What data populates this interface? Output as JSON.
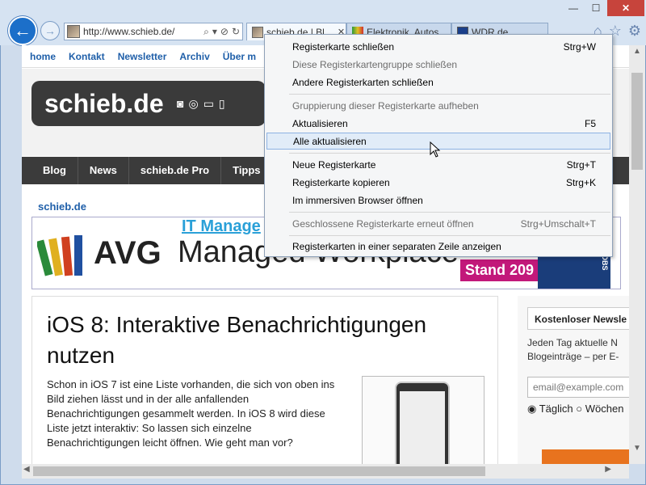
{
  "browser": {
    "address": "http://www.schieb.de/",
    "tabs": [
      {
        "label": "schieb.de | Bl...",
        "active": true
      },
      {
        "label": "Elektronik, Autos ...",
        "active": false
      },
      {
        "label": "WDR.de",
        "active": false
      }
    ],
    "window_controls": {
      "minimize": "—",
      "maximize": "☐",
      "close": "✕"
    },
    "icons": [
      "home-icon",
      "favorites-star-icon",
      "settings-gear-icon"
    ]
  },
  "page": {
    "topnav": [
      "home",
      "Kontakt",
      "Newsletter",
      "Archiv",
      "Über m"
    ],
    "logo": "schieb.de",
    "mainnav": [
      "Blog",
      "News",
      "schieb.de Pro",
      "Tipps"
    ],
    "site_label": "schieb.de",
    "banner": {
      "it_manage": "IT Manage",
      "brand": "AVG",
      "headline": "Managed Workplace",
      "stand": "Stand 209",
      "side_text": "JAKOBS"
    },
    "article": {
      "title": "iOS 8: Interaktive Benachrichtigungen nutzen",
      "body": "Schon in iOS 7 ist eine Liste vorhanden, die sich von oben ins Bild ziehen lässt und in der alle anfallenden Benachrichtigungen gesammelt werden. In iOS 8 wird diese Liste jetzt interaktiv: So lassen sich einzelne Benachrichtigungen leicht öffnen. Wie geht man vor?"
    },
    "sidebar": {
      "heading": "Kostenloser Newsle",
      "text_line1": "Jeden Tag aktuelle N",
      "text_line2": "Blogeinträge – per E-",
      "email_placeholder": "email@example.com",
      "radio_daily": "Täglich",
      "radio_weekly": "Wöchen"
    }
  },
  "context_menu": {
    "items": [
      {
        "label": "Registerkarte schließen",
        "shortcut": "Strg+W",
        "disabled": false
      },
      {
        "label": "Diese Registerkartengruppe schließen",
        "shortcut": "",
        "disabled": true
      },
      {
        "label": "Andere Registerkarten schließen",
        "shortcut": "",
        "disabled": false
      },
      {
        "label": "Gruppierung dieser Registerkarte aufheben",
        "shortcut": "",
        "disabled": true
      },
      {
        "label": "Aktualisieren",
        "shortcut": "F5",
        "disabled": false
      },
      {
        "label": "Alle aktualisieren",
        "shortcut": "",
        "disabled": false,
        "hover": true
      },
      {
        "label": "Neue Registerkarte",
        "shortcut": "Strg+T",
        "disabled": false
      },
      {
        "label": "Registerkarte kopieren",
        "shortcut": "Strg+K",
        "disabled": false
      },
      {
        "label": "Im immersiven Browser öffnen",
        "shortcut": "",
        "disabled": false
      },
      {
        "label": "Geschlossene Registerkarte erneut öffnen",
        "shortcut": "Strg+Umschalt+T",
        "disabled": true
      },
      {
        "label": "Registerkarten in einer separaten Zeile anzeigen",
        "shortcut": "",
        "disabled": false
      }
    ]
  },
  "colors": {
    "accent_blue": "#1f5fa9",
    "menu_hover": "#e1ecf8",
    "close_red": "#c7443c"
  }
}
